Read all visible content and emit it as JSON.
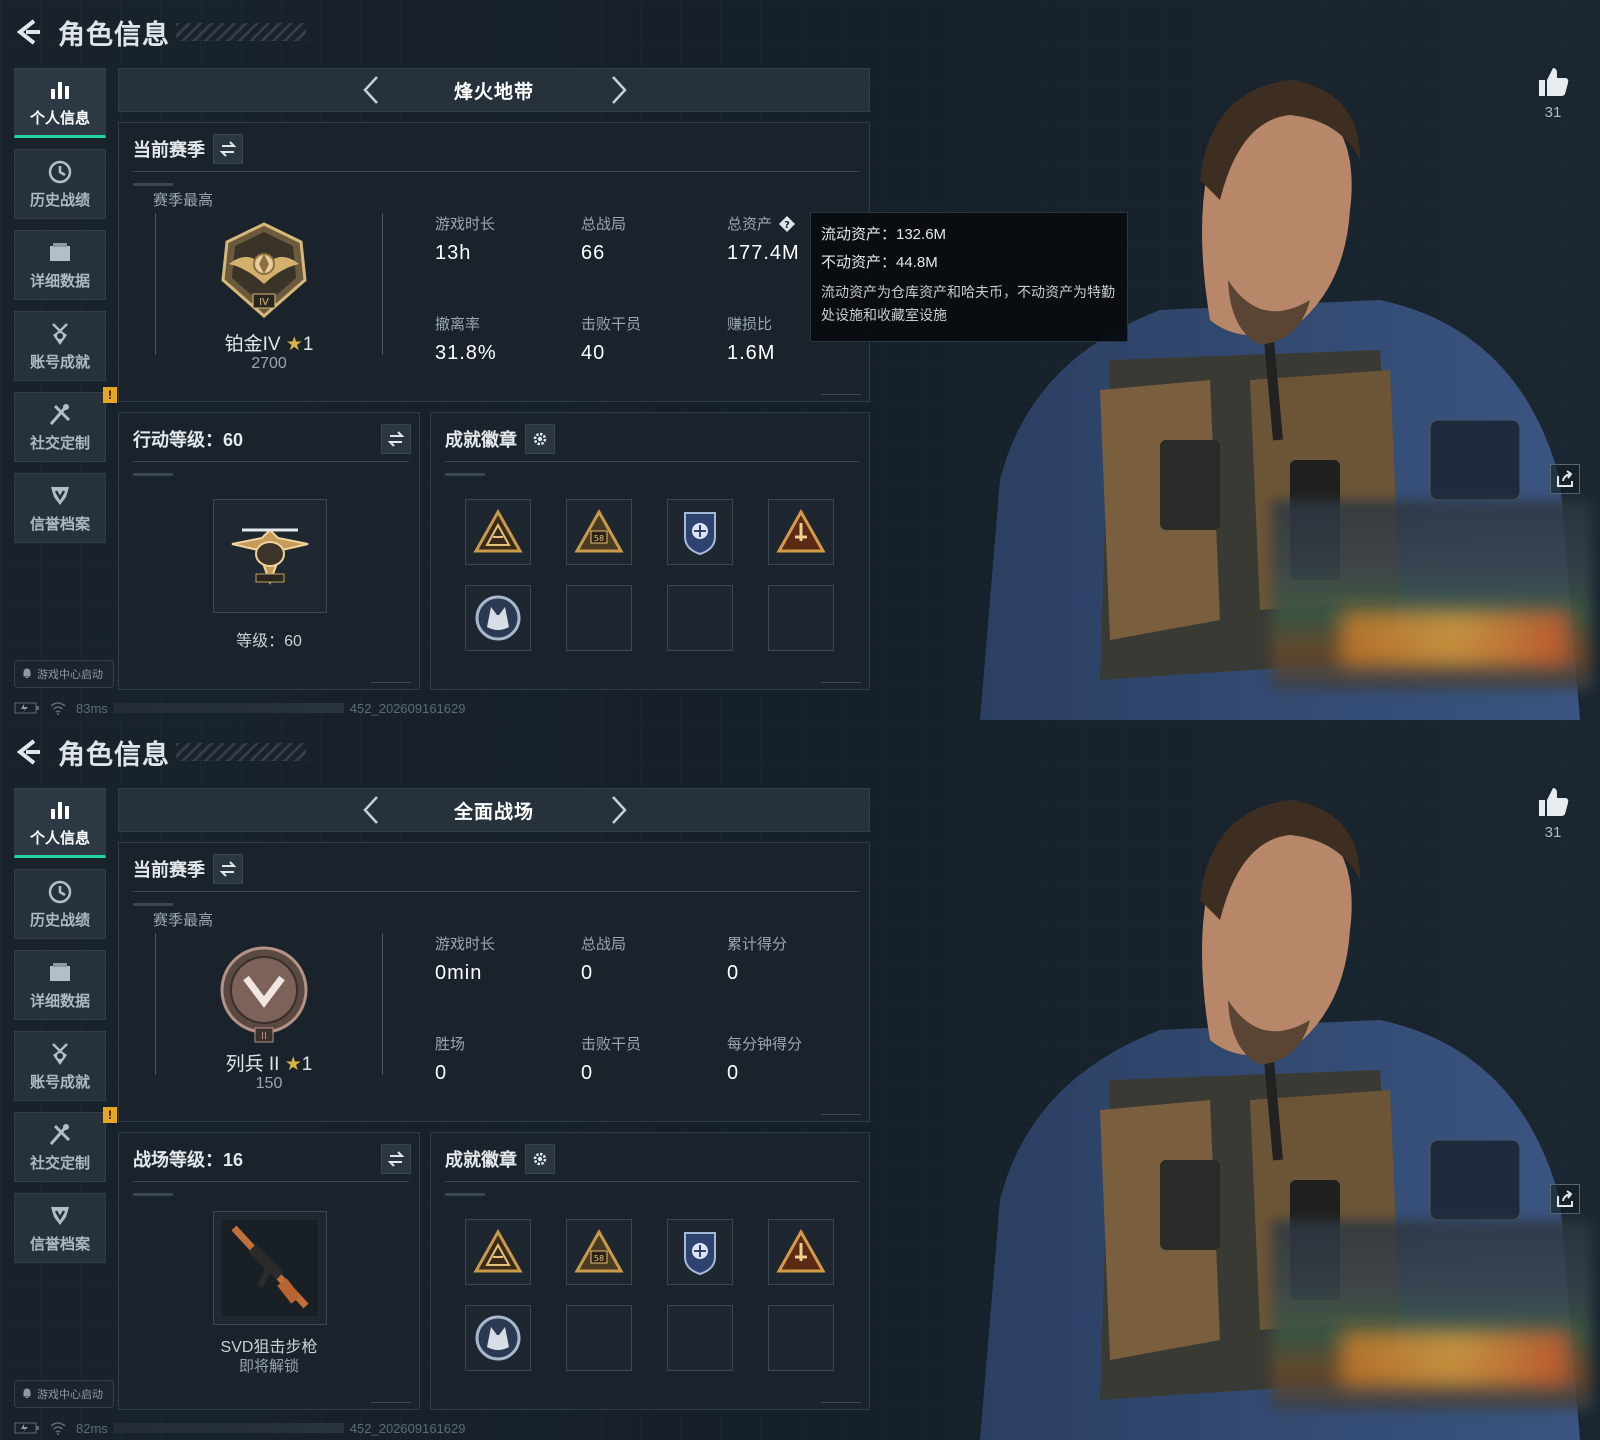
{
  "screens": [
    {
      "id": "top",
      "header": {
        "title": "角色信息"
      },
      "nav": [
        {
          "label": "个人信息",
          "icon": "bar-chart-icon",
          "active": true
        },
        {
          "label": "历史战绩",
          "icon": "clock-icon"
        },
        {
          "label": "详细数据",
          "icon": "folder-icon"
        },
        {
          "label": "账号成就",
          "icon": "medal-icon"
        },
        {
          "label": "社交定制",
          "icon": "tools-icon",
          "badge": "!"
        },
        {
          "label": "信誉档案",
          "icon": "shield-icon"
        }
      ],
      "launch_label": "游戏中心启动",
      "status": {
        "ping": "83ms",
        "build": "452_202609161629"
      },
      "mode": {
        "title": "烽火地带"
      },
      "season": {
        "title": "当前赛季",
        "best_label": "赛季最高",
        "rank_name": "铂金IV",
        "rank_stars": "1",
        "rank_points": "2700",
        "stats": [
          {
            "label": "游戏时长",
            "value": "13h"
          },
          {
            "label": "总战局",
            "value": "66"
          },
          {
            "label": "总资产",
            "value": "177.4M",
            "help": true
          },
          {
            "label": "撤离率",
            "value": "31.8%"
          },
          {
            "label": "击败干员",
            "value": "40"
          },
          {
            "label": "赚损比",
            "value": "1.6M"
          }
        ]
      },
      "tooltip": {
        "line1": "流动资产：132.6M",
        "line2": "不动资产：44.8M",
        "note": "流动资产为仓库资产和哈夫币，不动资产为特勤处设施和收藏室设施"
      },
      "level_panel": {
        "title": "行动等级：60",
        "value": "等级：60",
        "sub": ""
      },
      "badges": {
        "title": "成就徽章",
        "filled": [
          "delta-badge-1",
          "delta-badge-2",
          "police-badge",
          "delta-badge-3",
          "wolf-badge"
        ],
        "empty_slots": 3
      },
      "likes": "31"
    },
    {
      "id": "bottom",
      "header": {
        "title": "角色信息"
      },
      "nav": [
        {
          "label": "个人信息",
          "icon": "bar-chart-icon",
          "active": true
        },
        {
          "label": "历史战绩",
          "icon": "clock-icon"
        },
        {
          "label": "详细数据",
          "icon": "folder-icon"
        },
        {
          "label": "账号成就",
          "icon": "medal-icon"
        },
        {
          "label": "社交定制",
          "icon": "tools-icon",
          "badge": "!"
        },
        {
          "label": "信誉档案",
          "icon": "shield-icon"
        }
      ],
      "launch_label": "游戏中心启动",
      "status": {
        "ping": "82ms",
        "build": "452_202609161629"
      },
      "mode": {
        "title": "全面战场"
      },
      "season": {
        "title": "当前赛季",
        "best_label": "赛季最高",
        "rank_name": "列兵 II",
        "rank_stars": "1",
        "rank_points": "150",
        "stats": [
          {
            "label": "游戏时长",
            "value": "0min"
          },
          {
            "label": "总战局",
            "value": "0"
          },
          {
            "label": "累计得分",
            "value": "0"
          },
          {
            "label": "胜场",
            "value": "0"
          },
          {
            "label": "击败干员",
            "value": "0"
          },
          {
            "label": "每分钟得分",
            "value": "0"
          }
        ]
      },
      "level_panel": {
        "title": "战场等级：16",
        "value": "SVD狙击步枪",
        "sub": "即将解锁"
      },
      "badges": {
        "title": "成就徽章",
        "filled": [
          "delta-badge-1",
          "delta-badge-2",
          "police-badge",
          "delta-badge-3",
          "wolf-badge"
        ],
        "empty_slots": 3
      },
      "likes": "31"
    }
  ],
  "colors": {
    "accent": "#22d39b",
    "badge_warning": "#e8a623",
    "gold": "#d9b24a",
    "panel": "#1a232b"
  }
}
